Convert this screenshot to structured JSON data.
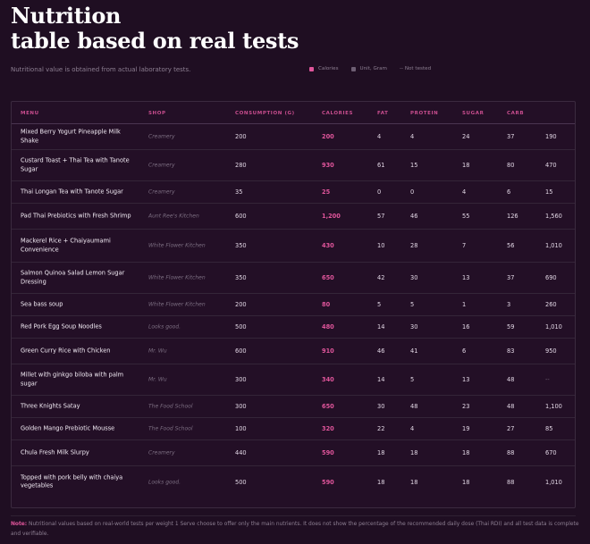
{
  "header": {
    "title_line1": "Nutrition",
    "title_line2": "table based on real tests",
    "subtitle": "Nutritional value is obtained from actual laboratory tests."
  },
  "legend": {
    "calories": "Calories",
    "unit": "Unit, Gram",
    "not_tested": "-- Not tested"
  },
  "colors": {
    "accent": "#e0559b",
    "background": "#1f0e22"
  },
  "table": {
    "columns": [
      "MENU",
      "SHOP",
      "CONSUMPTION (G)",
      "CALORIES",
      "FAT",
      "PROTEIN",
      "SUGAR",
      "CARB"
    ],
    "rows": [
      {
        "menu": "Mixed Berry Yogurt Pineapple Milk Shake",
        "shop": "Creamery",
        "consumption": "200",
        "calories": "200",
        "fat": "4",
        "protein": "4",
        "sugar": "24",
        "carb": "37",
        "extra": "190"
      },
      {
        "menu": "Custard Toast + Thai Tea with Tanote Sugar",
        "shop": "Creamery",
        "consumption": "280",
        "calories": "930",
        "fat": "61",
        "protein": "15",
        "sugar": "18",
        "carb": "80",
        "extra": "470"
      },
      {
        "menu": "Thai Longan Tea with Tanote Sugar",
        "shop": "Creamery",
        "consumption": "35",
        "calories": "25",
        "fat": "0",
        "protein": "0",
        "sugar": "4",
        "carb": "6",
        "extra": "15"
      },
      {
        "menu": "Pad Thai Prebiotics with Fresh Shrimp",
        "shop": "Aunt Ree's Kitchen",
        "consumption": "600",
        "calories": "1,200",
        "fat": "57",
        "protein": "46",
        "sugar": "55",
        "carb": "126",
        "extra": "1,560"
      },
      {
        "menu": "Mackerel Rice + Chaiyaumami Convenience",
        "shop": "White Flower Kitchen",
        "consumption": "350",
        "calories": "430",
        "fat": "10",
        "protein": "28",
        "sugar": "7",
        "carb": "56",
        "extra": "1,010"
      },
      {
        "menu": "Salmon Quinoa Salad Lemon Sugar Dressing",
        "shop": "White Flower Kitchen",
        "consumption": "350",
        "calories": "650",
        "fat": "42",
        "protein": "30",
        "sugar": "13",
        "carb": "37",
        "extra": "690"
      },
      {
        "menu": "Sea bass soup",
        "shop": "White Flower Kitchen",
        "consumption": "200",
        "calories": "80",
        "fat": "5",
        "protein": "5",
        "sugar": "1",
        "carb": "3",
        "extra": "260"
      },
      {
        "menu": "Red Pork Egg Soup Noodles",
        "shop": "Looks good.",
        "consumption": "500",
        "calories": "480",
        "fat": "14",
        "protein": "30",
        "sugar": "16",
        "carb": "59",
        "extra": "1,010"
      },
      {
        "menu": "Green Curry Rice with Chicken",
        "shop": "Mr. Wu",
        "consumption": "600",
        "calories": "910",
        "fat": "46",
        "protein": "41",
        "sugar": "6",
        "carb": "83",
        "extra": "950"
      },
      {
        "menu": "Millet with ginkgo biloba with palm sugar",
        "shop": "Mr. Wu",
        "consumption": "300",
        "calories": "340",
        "fat": "14",
        "protein": "5",
        "sugar": "13",
        "carb": "48",
        "extra": "--"
      },
      {
        "menu": "Three Knights Satay",
        "shop": "The Food School",
        "consumption": "300",
        "calories": "650",
        "fat": "30",
        "protein": "48",
        "sugar": "23",
        "carb": "48",
        "extra": "1,100"
      },
      {
        "menu": "Golden Mango Prebiotic Mousse",
        "shop": "The Food School",
        "consumption": "100",
        "calories": "320",
        "fat": "22",
        "protein": "4",
        "sugar": "19",
        "carb": "27",
        "extra": "85"
      },
      {
        "menu": "Chula Fresh Milk Slurpy",
        "shop": "Creamery",
        "consumption": "440",
        "calories": "590",
        "fat": "18",
        "protein": "18",
        "sugar": "18",
        "carb": "88",
        "extra": "670"
      },
      {
        "menu": "Topped with pork belly with chaiya vegetables",
        "shop": "Looks good.",
        "consumption": "500",
        "calories": "590",
        "fat": "18",
        "protein": "18",
        "sugar": "18",
        "carb": "88",
        "extra": "1,010"
      }
    ]
  },
  "note": {
    "label": "Note:",
    "text": "Nutritional values based on real-world tests per weight 1 Serve choose to offer only the main nutrients. It does not show the percentage of the recommended daily dose (Thai RDI) and all test data is complete and verifiable."
  }
}
